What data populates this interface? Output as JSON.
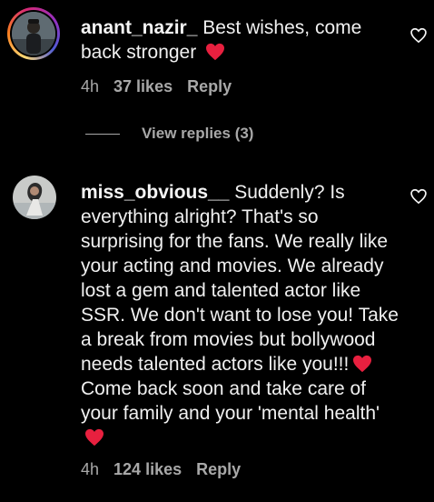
{
  "comments": [
    {
      "username": "anant_nazir_",
      "text": "Best wishes, come back stronger",
      "time": "4h",
      "likes": "37 likes",
      "reply": "Reply",
      "has_story_ring": true
    },
    {
      "username": "miss_obvious__",
      "text": "Suddenly? Is everything alright? That's so surprising for the fans. We really like your acting and movies. We already lost a gem and talented actor like SSR. We don't want to lose you! Take a break from movies but bollywood needs talented actors like you!!!",
      "text2": "Come back soon and take care of your family and your 'mental health'",
      "time": "4h",
      "likes": "124 likes",
      "reply": "Reply",
      "has_story_ring": false
    }
  ],
  "view_replies": "View replies (3)",
  "colors": {
    "background": "#000000",
    "text": "#f5f5f5",
    "muted": "#a8a8a8",
    "heart_emoji": "#e8203f"
  },
  "icons": {
    "like": "heart-outline-icon",
    "emoji": "red-heart-emoji"
  }
}
